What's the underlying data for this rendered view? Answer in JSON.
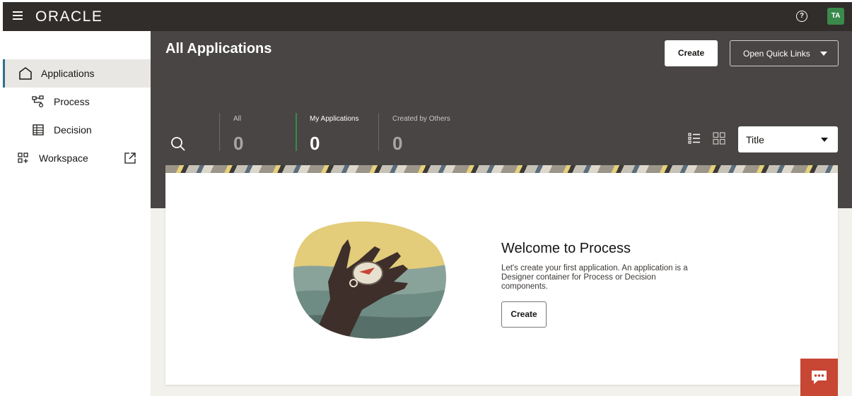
{
  "brand": {
    "logo_text": "ORACLE",
    "user_initials": "TA",
    "help_symbol": "?"
  },
  "icons": {
    "menu": "hamburger-icon",
    "help": "help-icon",
    "applications": "home-icon",
    "process": "process-flow-icon",
    "decision": "table-icon",
    "workspace": "workspace-grid-icon",
    "external": "external-link-icon",
    "search": "search-icon",
    "list_view": "list-view-icon",
    "grid_view": "grid-view-icon",
    "chat": "chat-icon"
  },
  "colors": {
    "topbar": "#312d2a",
    "header": "#484544",
    "active_nav_border": "#2d6f8c",
    "selected_filter": "#3a8a4b",
    "chat_button": "#c74634",
    "avatar": "#3a8a4b"
  },
  "sidebar": {
    "items": [
      {
        "label": "Applications",
        "active": true
      },
      {
        "label": "Process"
      },
      {
        "label": "Decision"
      },
      {
        "label": "Workspace"
      }
    ]
  },
  "header": {
    "title": "All Applications",
    "create_label": "Create",
    "quick_links_label": "Open Quick Links",
    "filters": [
      {
        "label": "All",
        "count": "0"
      },
      {
        "label": "My Applications",
        "count": "0",
        "selected": true
      },
      {
        "label": "Created by Others",
        "count": "0"
      }
    ],
    "sort_value": "Title"
  },
  "welcome": {
    "title": "Welcome to Process",
    "description": "Let's create your first application. An application is a Designer container for Process or Decision components.",
    "create_label": "Create"
  }
}
